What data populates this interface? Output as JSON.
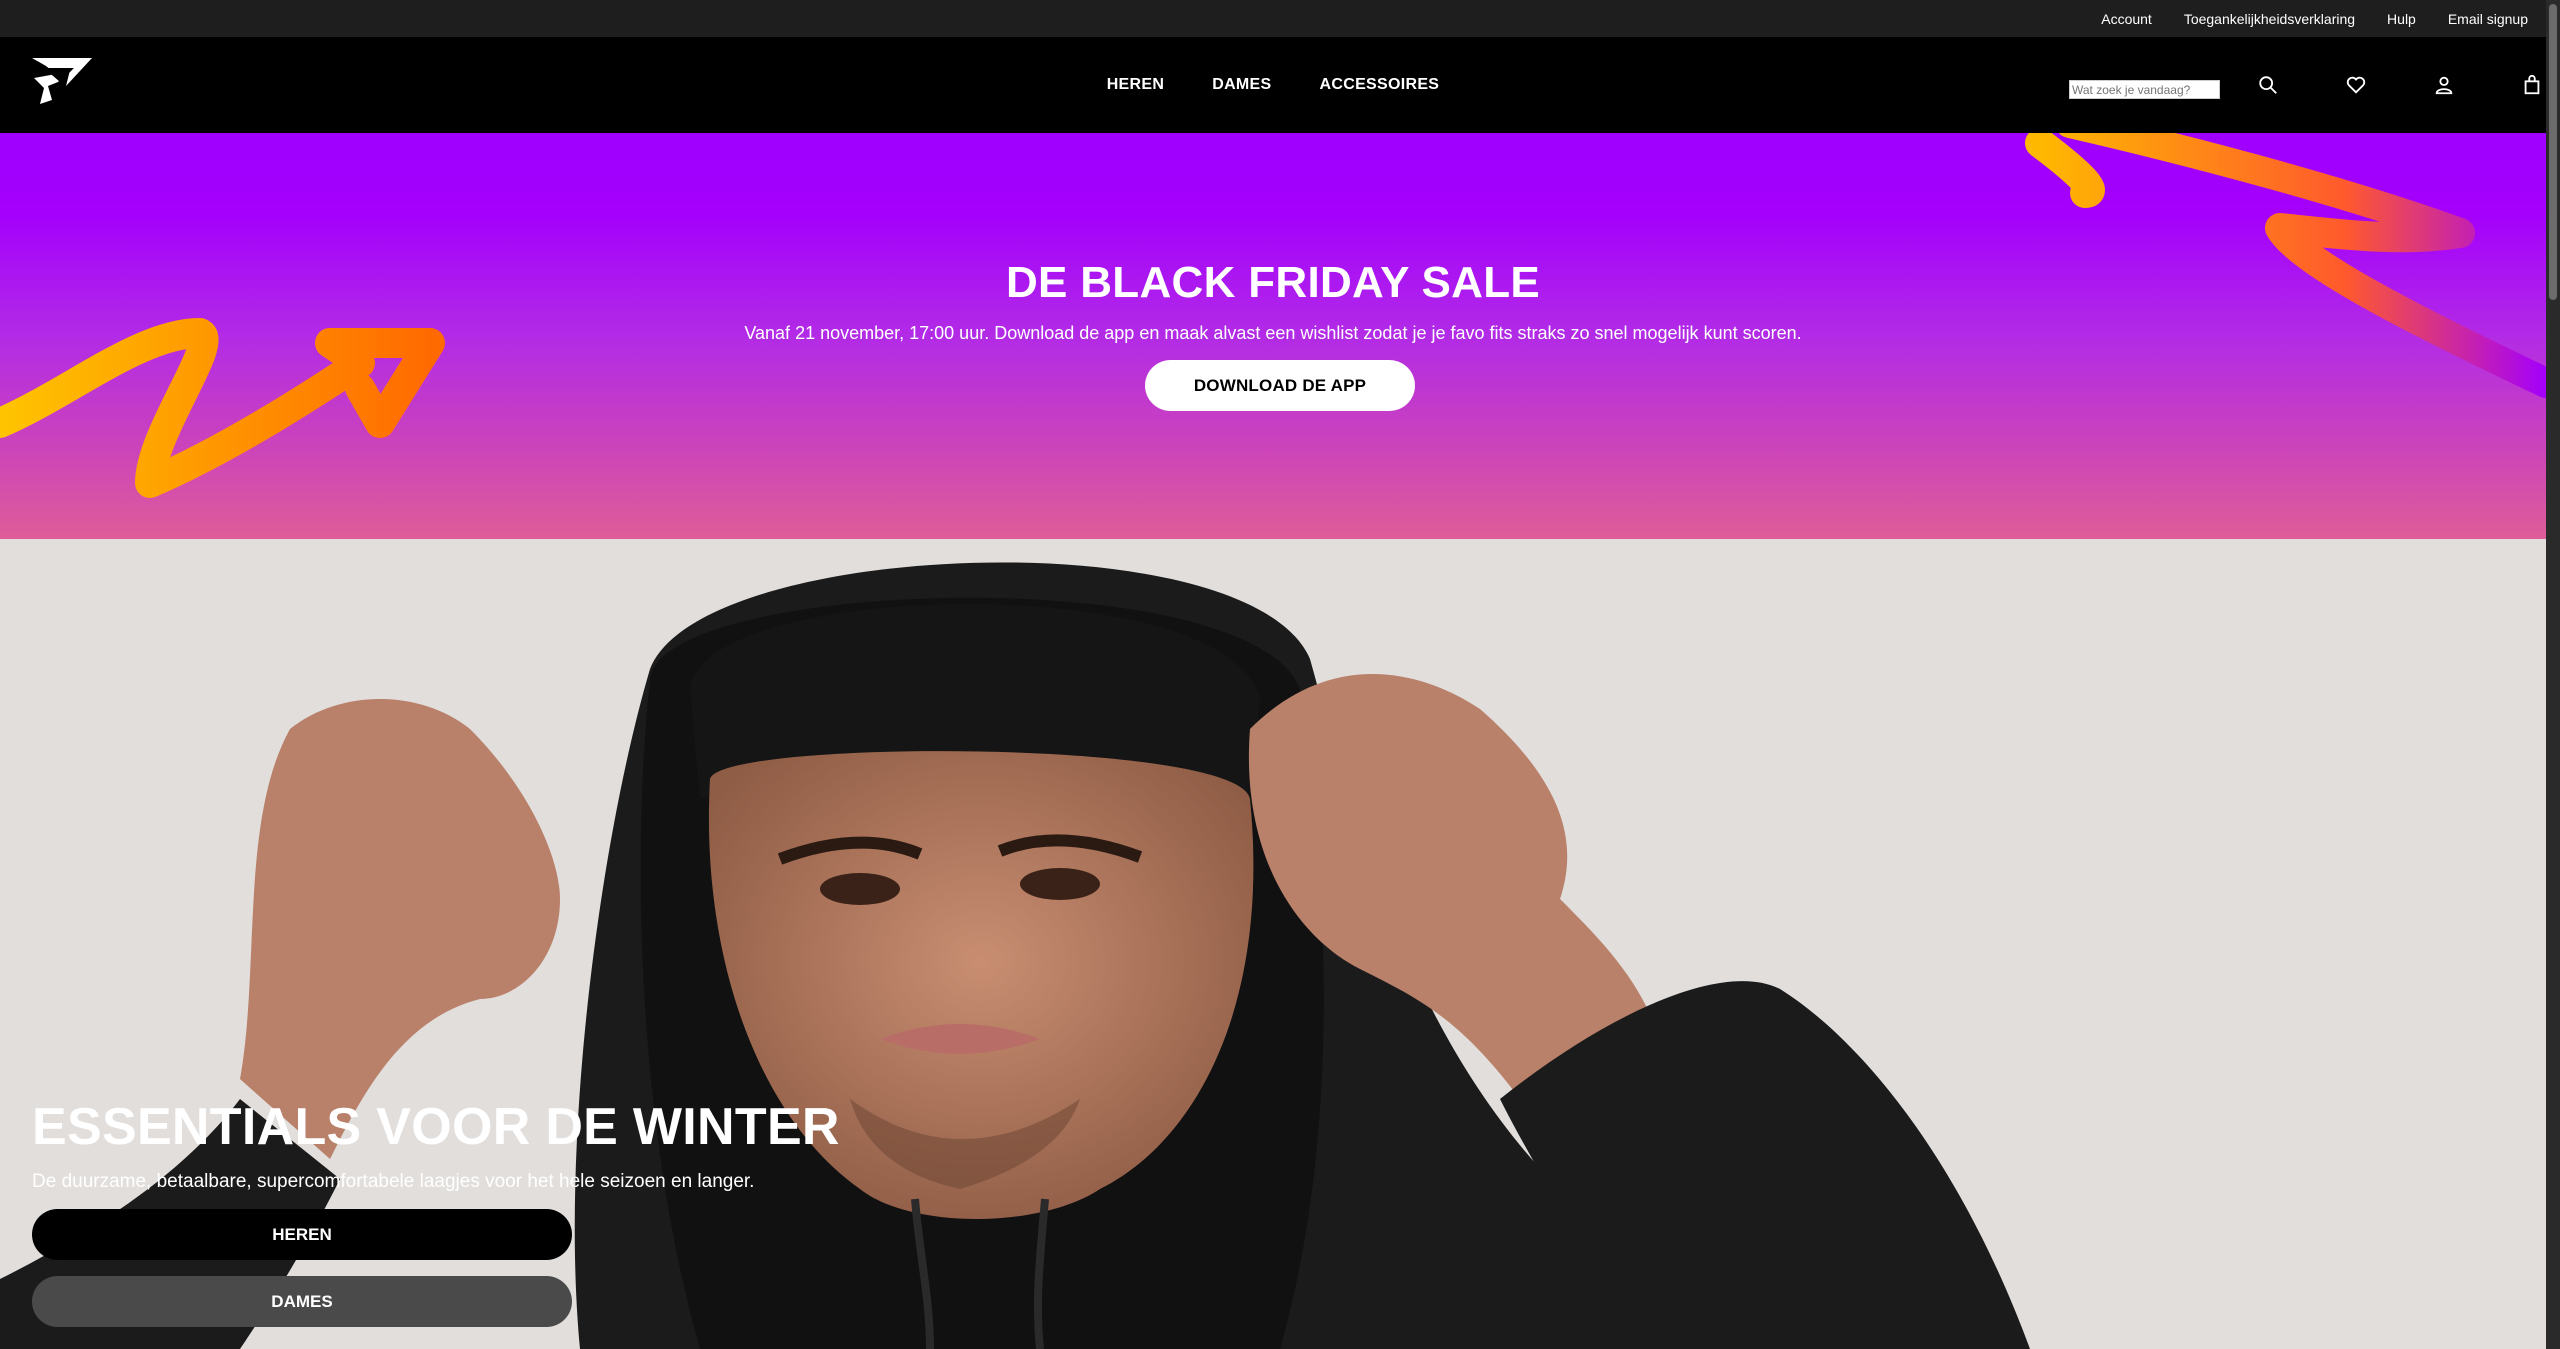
{
  "utility_links": [
    "Account",
    "Toegankelijkheidsverklaring",
    "Hulp",
    "Email signup"
  ],
  "nav": {
    "items": [
      "HEREN",
      "DAMES",
      "ACCESSOIRES"
    ]
  },
  "search": {
    "placeholder": "Wat zoek je vandaag?"
  },
  "icons": {
    "logo": "gymshark-logo",
    "search": "search-icon",
    "wishlist": "heart-icon",
    "account": "user-icon",
    "bag": "shopping-bag-icon"
  },
  "banner": {
    "title": "DE BLACK FRIDAY SALE",
    "subtitle": "Vanaf 21 november, 17:00 uur. Download de app en maak alvast een wishlist zodat je je favo fits straks zo snel mogelijk kunt scoren.",
    "button": "DOWNLOAD DE APP"
  },
  "hero": {
    "title": "ESSENTIALS VOOR DE WINTER",
    "subtitle": "De duurzame, betaalbare, supercomfortabele laagjes voor het hele seizoen en langer.",
    "buttons": [
      "HEREN",
      "DAMES"
    ]
  },
  "colors": {
    "banner_top": "#9f00ff",
    "banner_bottom": "#df5d98",
    "hero_bg": "#e1dedc"
  }
}
